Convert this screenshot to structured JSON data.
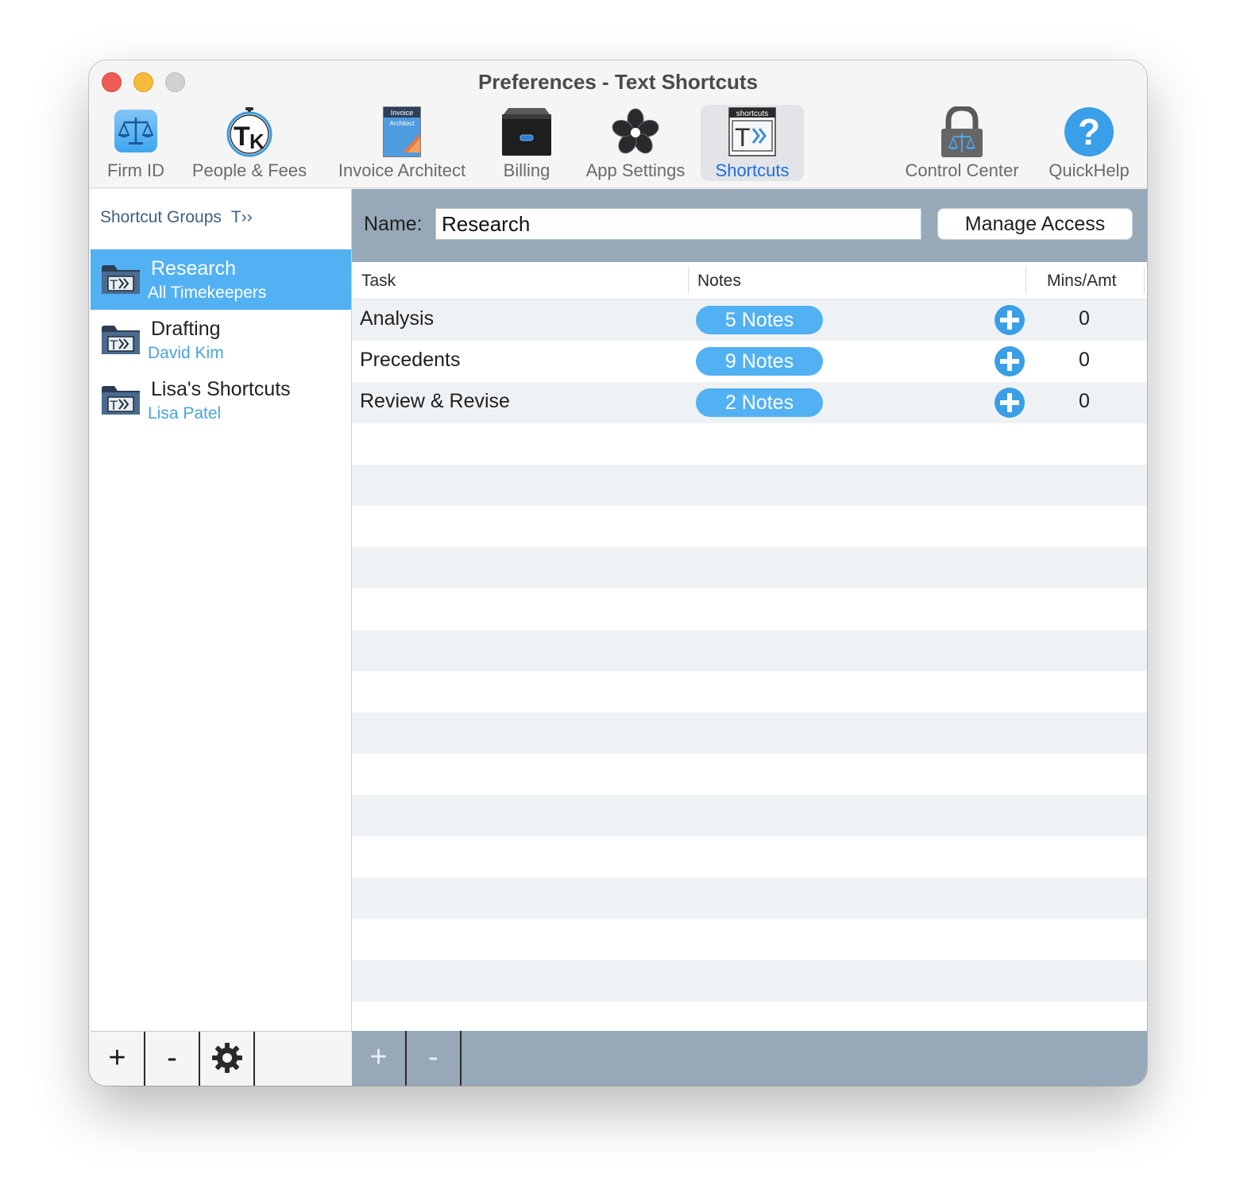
{
  "window": {
    "title": "Preferences - Text Shortcuts"
  },
  "toolbar": {
    "items": [
      {
        "label": "Firm ID",
        "icon": "scales-icon"
      },
      {
        "label": "People & Fees",
        "icon": "timekeeper-tk-icon"
      },
      {
        "label": "Invoice Architect",
        "icon": "invoice-architect-icon",
        "icon_text_top": "Invoice",
        "icon_text_sub": "Architect"
      },
      {
        "label": "Billing",
        "icon": "file-drawer-icon"
      },
      {
        "label": "App Settings",
        "icon": "flower-icon"
      },
      {
        "label": "Shortcuts",
        "icon": "shortcuts-icon",
        "icon_text": "shortcuts",
        "selected": true
      },
      {
        "label": "Control Center",
        "icon": "padlock-icon"
      },
      {
        "label": "QuickHelp",
        "icon": "question-icon"
      }
    ]
  },
  "sidebar": {
    "header": "Shortcut Groups",
    "header_glyph": "T››",
    "groups": [
      {
        "name": "Research",
        "subtitle": "All Timekeepers",
        "selected": true
      },
      {
        "name": "Drafting",
        "subtitle": "David Kim"
      },
      {
        "name": "Lisa's Shortcuts",
        "subtitle": "Lisa Patel"
      }
    ],
    "footer": {
      "add": "+",
      "remove": "-",
      "settings_icon": "gear-icon"
    }
  },
  "detail": {
    "name_label": "Name:",
    "name_value": "Research",
    "manage_access": "Manage Access",
    "columns": {
      "task": "Task",
      "notes": "Notes",
      "amount": "Mins/Amt"
    },
    "rows": [
      {
        "task": "Analysis",
        "notes": "5 Notes",
        "amount": "0"
      },
      {
        "task": "Precedents",
        "notes": "9 Notes",
        "amount": "0"
      },
      {
        "task": "Review & Revise",
        "notes": "2 Notes",
        "amount": "0"
      }
    ],
    "footer": {
      "add": "+",
      "remove": "-"
    }
  },
  "colors": {
    "accent": "#52b1f2",
    "selected_tab_text": "#1e6fe0",
    "header_bar": "#97a9b8",
    "row_alt": "#eff2f5"
  }
}
